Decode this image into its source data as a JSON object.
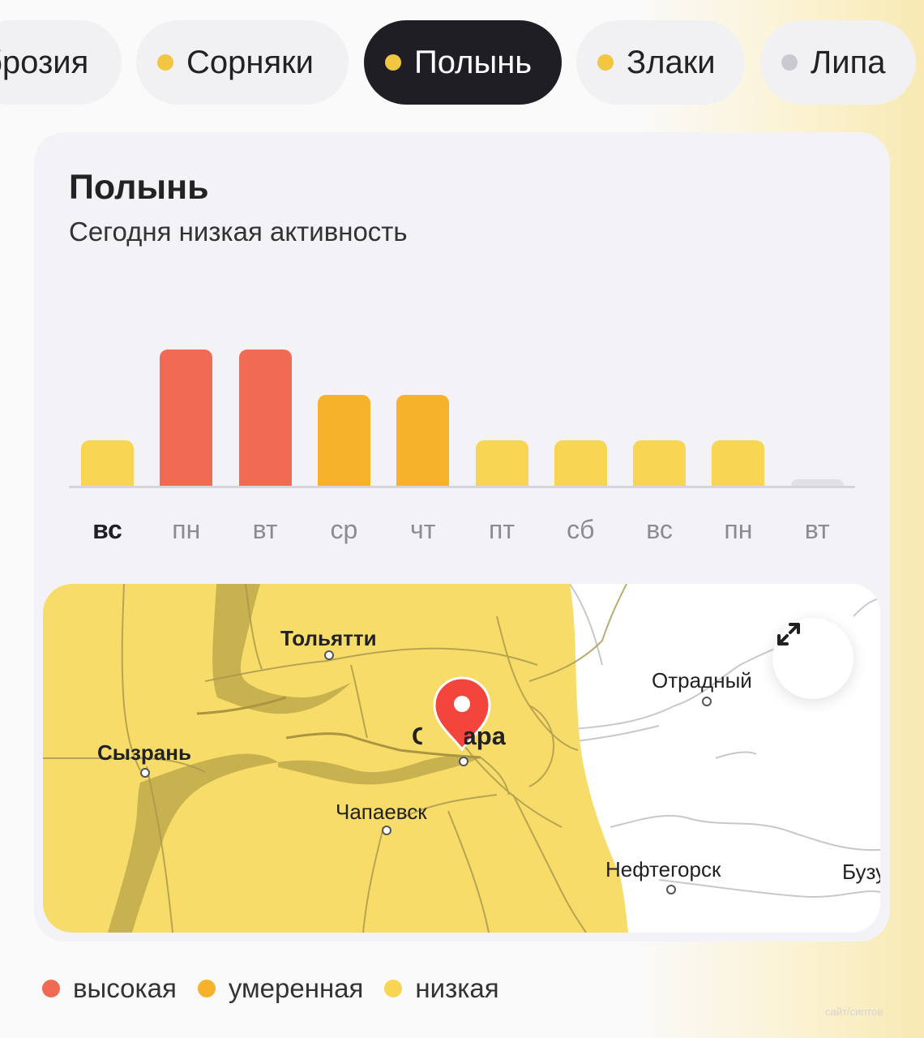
{
  "tabs": [
    {
      "label": "брозия",
      "dot_color": null,
      "active": false
    },
    {
      "label": "Сорняки",
      "dot_color": "#f2c641",
      "active": false
    },
    {
      "label": "Полынь",
      "dot_color": "#f2c641",
      "active": true
    },
    {
      "label": "Злаки",
      "dot_color": "#f2c641",
      "active": false
    },
    {
      "label": "Липа",
      "dot_color": "#c9c9d1",
      "active": false
    }
  ],
  "card": {
    "title": "Полынь",
    "subtitle": "Сегодня низкая активность"
  },
  "chart_data": {
    "type": "bar",
    "categories": [
      "вс",
      "пн",
      "вт",
      "ср",
      "чт",
      "пт",
      "сб",
      "вс",
      "пн",
      "вт"
    ],
    "levels": [
      "низкая",
      "высокая",
      "высокая",
      "умеренная",
      "умеренная",
      "низкая",
      "низкая",
      "низкая",
      "низкая",
      "нет данных"
    ],
    "values": [
      1,
      3,
      3,
      2,
      2,
      1,
      1,
      1,
      1,
      0
    ],
    "current_index": 0,
    "ylim": [
      0,
      3
    ],
    "grid": false,
    "colors": {
      "высокая": "#f06a54",
      "умеренная": "#f6b22a",
      "низкая": "#f8d552",
      "нет данных": "#e0e0e6"
    }
  },
  "map": {
    "cities": {
      "tolyatti": "Тольятти",
      "syzran": "Сызрань",
      "samara": "Самара",
      "chapaevsk": "Чапаевск",
      "otradny": "Отрадный",
      "neftegorsk": "Нефтегорск",
      "buz": "Бузу"
    },
    "zone_color": "#f7dc6a",
    "pin_color": "#f3453b",
    "expand_icon": "expand-arrows-icon"
  },
  "legend": [
    {
      "label": "высокая",
      "color": "#f06a54"
    },
    {
      "label": "умеренная",
      "color": "#f6b22a"
    },
    {
      "label": "низкая",
      "color": "#f8d552"
    }
  ],
  "watermark": "сайт/сиптов"
}
